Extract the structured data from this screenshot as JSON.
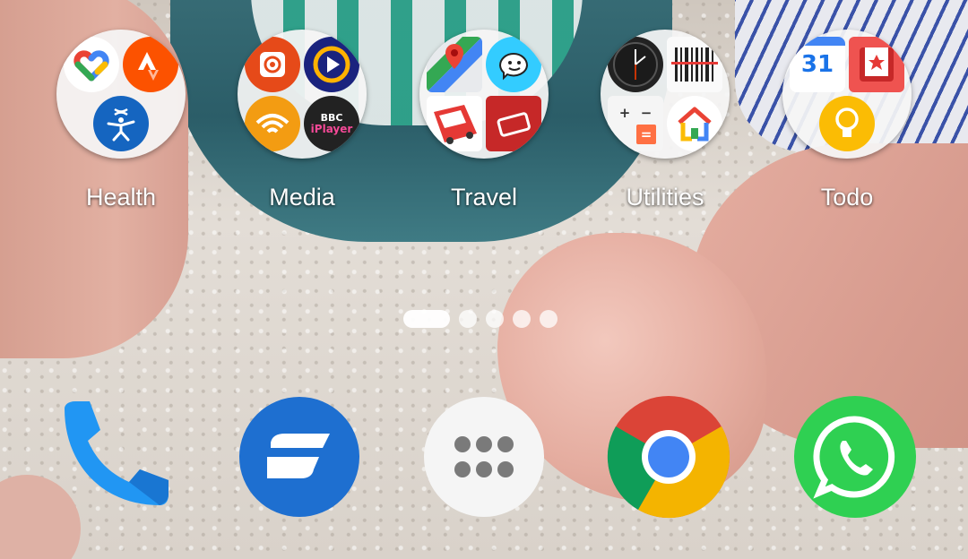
{
  "folders": [
    {
      "label": "Health",
      "apps": [
        "google-fit-icon",
        "strava-icon",
        "under-armour-icon"
      ]
    },
    {
      "label": "Media",
      "apps": [
        "podcast-addict-icon",
        "player-fm-icon",
        "audible-icon",
        "bbc-iplayer-icon"
      ]
    },
    {
      "label": "Travel",
      "apps": [
        "google-maps-icon",
        "waze-icon",
        "bus-app-icon",
        "ticket-app-icon"
      ]
    },
    {
      "label": "Utilities",
      "apps": [
        "clock-icon",
        "barcode-scanner-icon",
        "calculator-icon",
        "google-home-icon"
      ]
    },
    {
      "label": "Todo",
      "apps": [
        "google-calendar-icon",
        "pocket-icon",
        "google-keep-icon"
      ]
    }
  ],
  "mini_labels": {
    "calendar_day": "31",
    "bbc_top": "BBC",
    "bbc_bottom": "iPlayer",
    "calc_plus": "+",
    "calc_minus": "−",
    "calc_eq": "="
  },
  "page_indicator": {
    "pages": 5,
    "current": 1
  },
  "dock": [
    {
      "name": "phone"
    },
    {
      "name": "stream-app"
    },
    {
      "name": "app-drawer"
    },
    {
      "name": "chrome"
    },
    {
      "name": "whatsapp"
    }
  ],
  "colors": {
    "folder_bg": "#f5f5f5",
    "chrome_red": "#db4437",
    "chrome_green": "#0f9d58",
    "chrome_yellow": "#f4b400",
    "chrome_blue": "#4285f4",
    "whatsapp_green": "#2fd052",
    "phone_blue": "#2196f3",
    "stream_blue": "#1e6fd0"
  }
}
